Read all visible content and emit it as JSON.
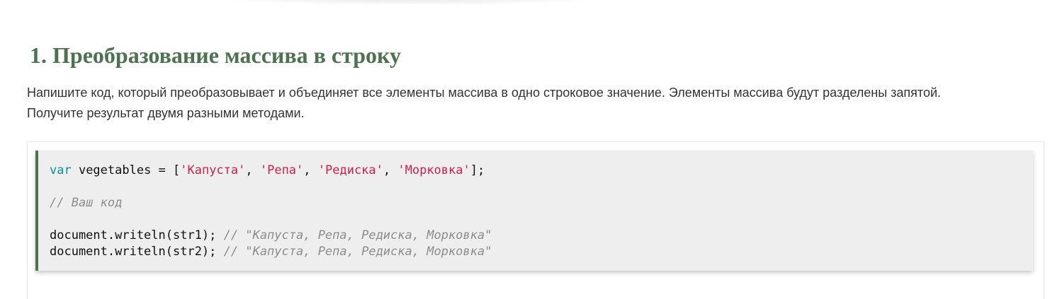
{
  "task": {
    "title": "1. Преобразование массива в строку",
    "description_line1": "Напишите код, который преобразовывает и объединяет все элементы массива в одно строковое значение. Элементы массива будут разделены запятой.",
    "description_line2": "Получите результат двумя разными методами."
  },
  "code": {
    "line1": {
      "keyword": "var",
      "declaration": " vegetables = [",
      "items": [
        "'Капуста'",
        "'Репа'",
        "'Редиска'",
        "'Морковка'"
      ],
      "separator": ", ",
      "closing": "];"
    },
    "line2": {
      "comment": "// Ваш код"
    },
    "line3": {
      "call": "document.writeln(str1); ",
      "comment": "// \"Капуста, Репа, Редиска, Морковка\""
    },
    "line4": {
      "call": "document.writeln(str2); ",
      "comment": "// \"Капуста, Репа, Редиска, Морковка\""
    }
  },
  "colors": {
    "heading": "#4d7250",
    "keyword": "#0a8f9c",
    "string": "#cc1f4f",
    "comment": "#8c8c8c",
    "code_background": "#eeeeee"
  }
}
